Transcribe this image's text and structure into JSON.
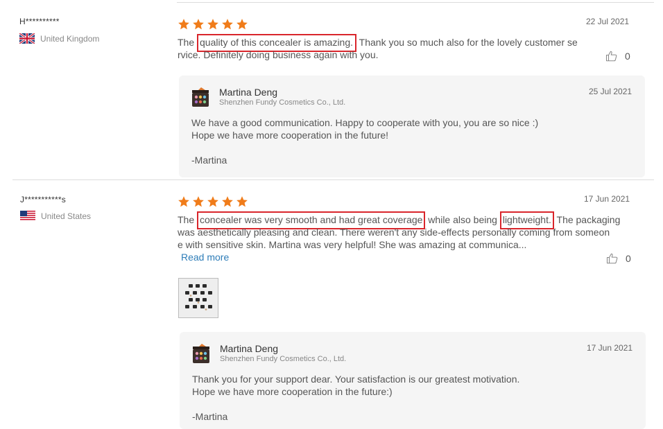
{
  "accent_star": "#f07c1a",
  "highlight_color": "#d9252b",
  "reviews": [
    {
      "name": "H**********",
      "country": "United Kingdom",
      "flag": "uk-flag",
      "rating": 5,
      "date": "22 Jul 2021",
      "text": {
        "pre": "The ",
        "hl1": "quality of this concealer is amazing.",
        "post1": " Thank you so much also for the lovely customer se",
        "line2": "rvice. Definitely doing business again with you."
      },
      "likes": "0",
      "reply": {
        "seller": "Martina Deng",
        "company": "Shenzhen Fundy Cosmetics Co., Ltd.",
        "date": "25 Jul 2021",
        "line1": "We have a good communication. Happy to cooperate with you, you are so nice :)",
        "line2": "Hope we have more cooperation in the future!",
        "sign": "-Martina"
      }
    },
    {
      "name": "J***********s",
      "country": "United States",
      "flag": "us-flag",
      "rating": 5,
      "date": "17 Jun 2021",
      "text": {
        "pre": "The ",
        "hl1": "concealer was very smooth and had great coverage",
        "mid": " while also being ",
        "hl2": "lightweight.",
        "post": " The packaging",
        "line2": "was aesthetically pleasing and clean. There weren't any side-effects personally coming from someon",
        "line3": "e with sensitive skin.  Martina was very helpful!  She was amazing at communica..."
      },
      "read_more": "Read more",
      "likes": "0",
      "photo": "product-photo",
      "reply": {
        "seller": "Martina Deng",
        "company": "Shenzhen Fundy Cosmetics Co., Ltd.",
        "date": "17 Jun 2021",
        "line1": "Thank you for your support dear. Your satisfaction is our greatest motivation.",
        "line2": "Hope we have more cooperation in the future:)",
        "sign": "-Martina"
      }
    }
  ]
}
